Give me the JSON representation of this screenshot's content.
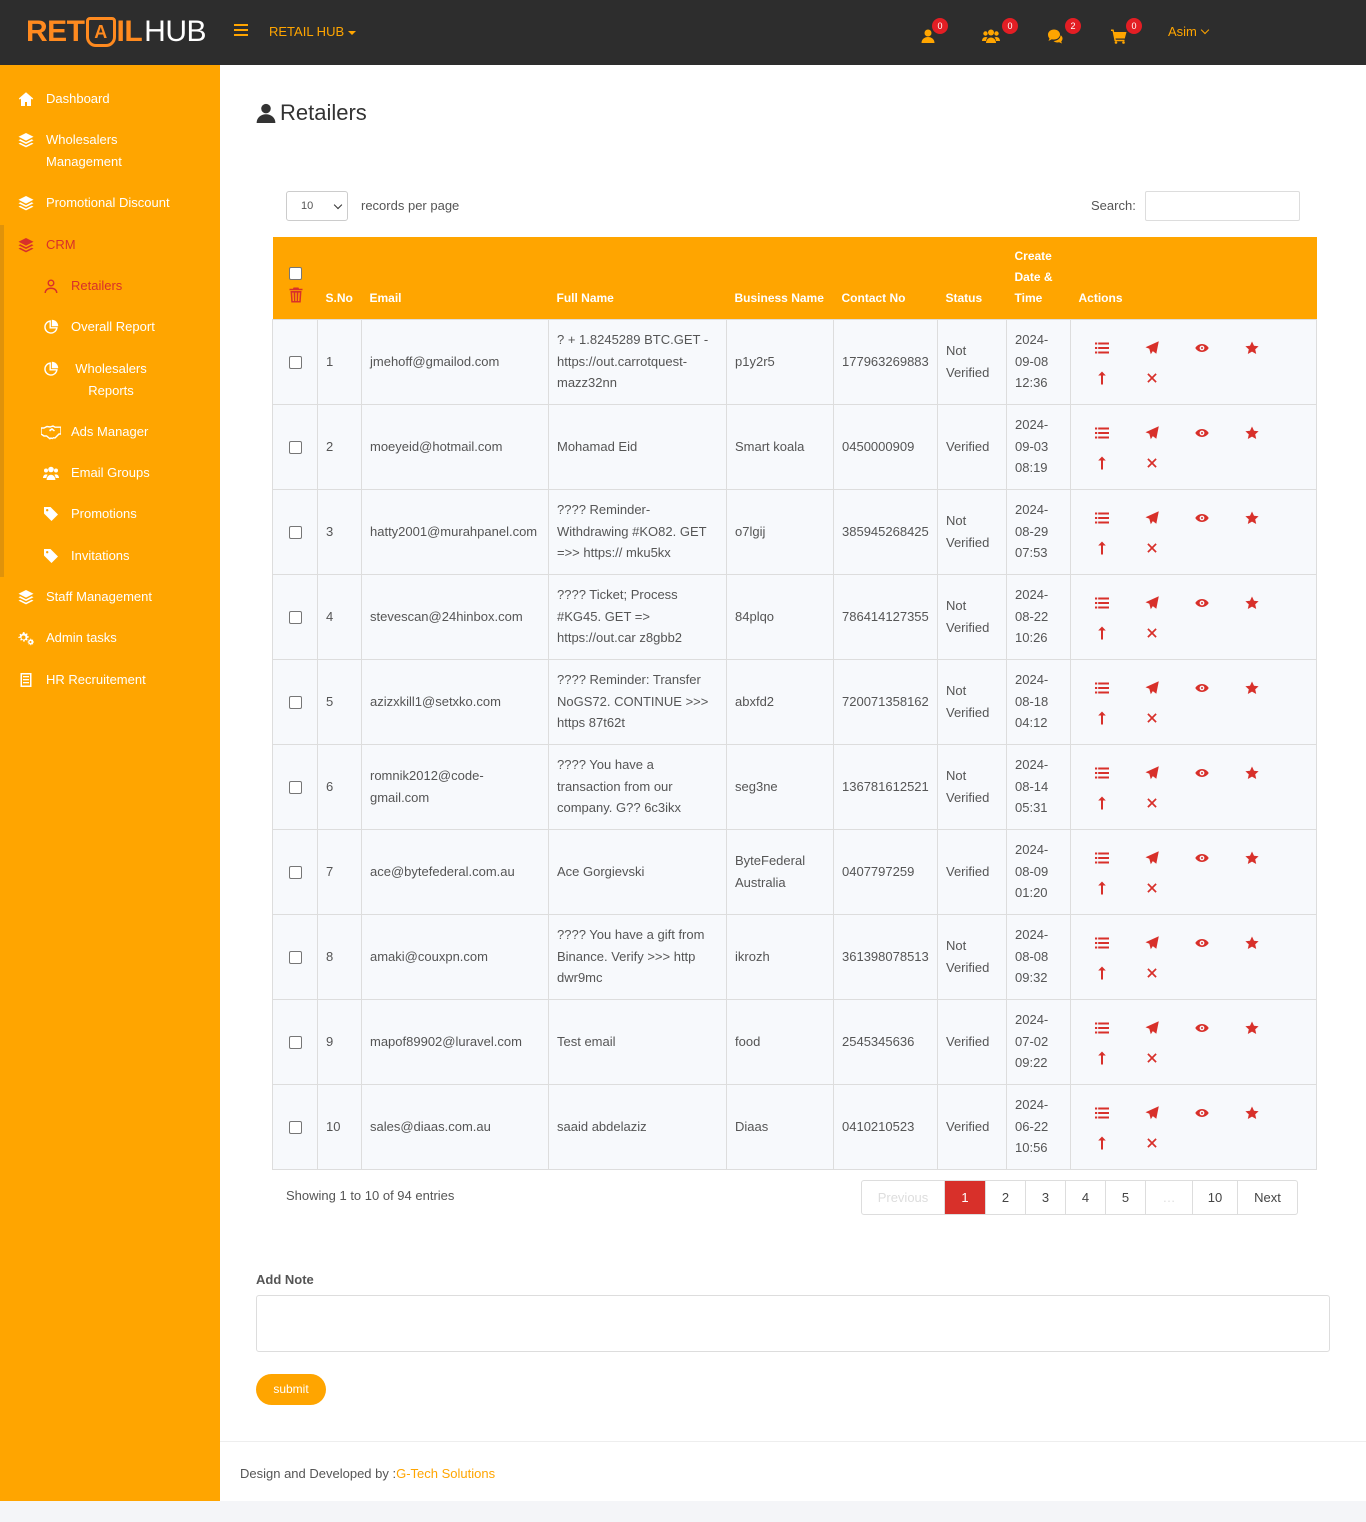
{
  "brand": {
    "logo_ret": "RET",
    "logo_a": "A",
    "logo_il": "IL",
    "logo_hub": "HUB",
    "menu_label": "RETAIL HUB"
  },
  "topbar": {
    "badges": {
      "user": "0",
      "group": "0",
      "chat": "2",
      "cart": "0"
    },
    "user_name": "Asim"
  },
  "sidebar": {
    "items": [
      {
        "label": "Dashboard"
      },
      {
        "label": "Wholesalers Management"
      },
      {
        "label": "Promotional Discount"
      },
      {
        "label": "CRM"
      },
      {
        "label": "Retailers"
      },
      {
        "label": "Overall Report"
      },
      {
        "label": "Wholesalers Reports"
      },
      {
        "label": "Ads Manager"
      },
      {
        "label": "Email Groups"
      },
      {
        "label": "Promotions"
      },
      {
        "label": "Invitations"
      },
      {
        "label": "Staff Management"
      },
      {
        "label": "Admin tasks"
      },
      {
        "label": "HR Recruitement"
      }
    ]
  },
  "page": {
    "title": "Retailers"
  },
  "table_controls": {
    "length_value": "10",
    "length_label": "records per page",
    "search_label": "Search:",
    "search_value": ""
  },
  "table": {
    "headers": [
      "S.No",
      "Email",
      "Full Name",
      "Business Name",
      "Contact No",
      "Status",
      "Create Date & Time",
      "Actions"
    ],
    "rows": [
      {
        "sno": "1",
        "email": "jmehoff@gmailod.com",
        "full_name": "? + 1.8245289 BTC.GET - https://out.carrotquest-mazz32nn",
        "business": "p1y2r5",
        "contact": "177963269883",
        "status": "Not Verified",
        "created": "2024-09-08 12:36"
      },
      {
        "sno": "2",
        "email": "moeyeid@hotmail.com",
        "full_name": "Mohamad Eid",
        "business": "Smart koala",
        "contact": "0450000909",
        "status": "Verified",
        "created": "2024-09-03 08:19"
      },
      {
        "sno": "3",
        "email": "hatty2001@murahpanel.com",
        "full_name": "???? Reminder- Withdrawing #KO82. GET =>> https:// mku5kx",
        "business": "o7lgij",
        "contact": "385945268425",
        "status": "Not Verified",
        "created": "2024-08-29 07:53"
      },
      {
        "sno": "4",
        "email": "stevescan@24hinbox.com",
        "full_name": "???? Ticket; Process #KG45. GET => https://out.car z8gbb2",
        "business": "84plqo",
        "contact": "786414127355",
        "status": "Not Verified",
        "created": "2024-08-22 10:26"
      },
      {
        "sno": "5",
        "email": "azizxkill1@setxko.com",
        "full_name": "???? Reminder: Transfer NoGS72. CONTINUE >>> https 87t62t",
        "business": "abxfd2",
        "contact": "720071358162",
        "status": "Not Verified",
        "created": "2024-08-18 04:12"
      },
      {
        "sno": "6",
        "email": "romnik2012@code-gmail.com",
        "full_name": "???? You have a transaction from our company. G?? 6c3ikx",
        "business": "seg3ne",
        "contact": "136781612521",
        "status": "Not Verified",
        "created": "2024-08-14 05:31"
      },
      {
        "sno": "7",
        "email": "ace@bytefederal.com.au",
        "full_name": "Ace Gorgievski",
        "business": "ByteFederal Australia",
        "contact": "0407797259",
        "status": "Verified",
        "created": "2024-08-09 01:20"
      },
      {
        "sno": "8",
        "email": "amaki@couxpn.com",
        "full_name": "???? You have a gift from Binance. Verify >>> http dwr9mc",
        "business": "ikrozh",
        "contact": "361398078513",
        "status": "Not Verified",
        "created": "2024-08-08 09:32"
      },
      {
        "sno": "9",
        "email": "mapof89902@luravel.com",
        "full_name": "Test email",
        "business": "food",
        "contact": "2545345636",
        "status": "Verified",
        "created": "2024-07-02 09:22"
      },
      {
        "sno": "10",
        "email": "sales@diaas.com.au",
        "full_name": "saaid abdelaziz",
        "business": "Diaas",
        "contact": "0410210523",
        "status": "Verified",
        "created": "2024-06-22 10:56"
      }
    ]
  },
  "pagination": {
    "info": "Showing 1 to 10 of 94 entries",
    "previous": "Previous",
    "pages": [
      "1",
      "2",
      "3",
      "4",
      "5",
      "…",
      "10"
    ],
    "next": "Next"
  },
  "note": {
    "label": "Add Note",
    "value": "",
    "submit_label": "submit"
  },
  "footer": {
    "text": "Design and Developed by :",
    "link": "G-Tech Solutions"
  },
  "colors": {
    "accent": "#ffa500",
    "topbar": "#2d2d2d",
    "danger": "#d8302a"
  }
}
